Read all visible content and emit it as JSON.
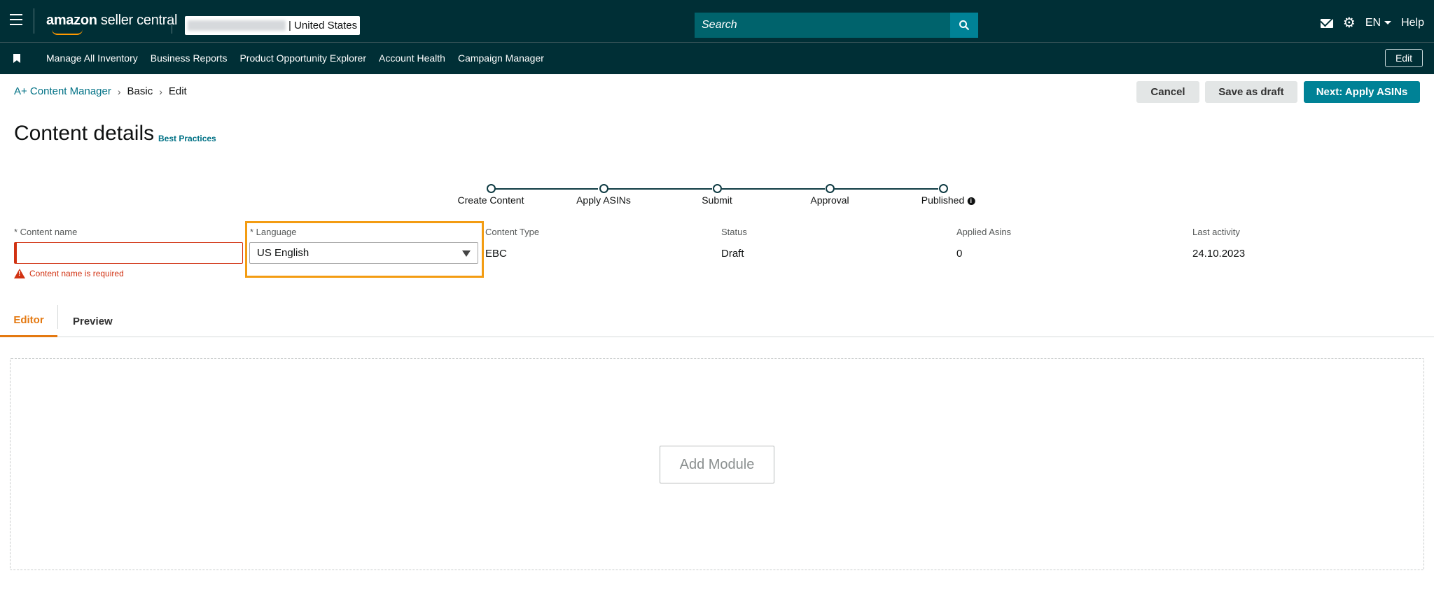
{
  "header": {
    "logo_bold": "amazon",
    "logo_rest": " seller central",
    "store_name": "| United States",
    "search_placeholder": "Search",
    "language": "EN",
    "help": "Help"
  },
  "nav": {
    "items": [
      "Manage All Inventory",
      "Business Reports",
      "Product Opportunity Explorer",
      "Account Health",
      "Campaign Manager"
    ],
    "edit_label": "Edit"
  },
  "breadcrumb": {
    "items": [
      "A+ Content Manager",
      "Basic",
      "Edit"
    ]
  },
  "actions": {
    "cancel": "Cancel",
    "save_draft": "Save as draft",
    "next": "Next: Apply ASINs"
  },
  "page": {
    "title": "Content details",
    "best_practices": "Best Practices"
  },
  "stepper": {
    "steps": [
      "Create Content",
      "Apply ASINs",
      "Submit",
      "Approval",
      "Published"
    ],
    "info_glyph": "i"
  },
  "form": {
    "content_name_label": "* Content name",
    "content_name_value": "",
    "content_name_error": "Content name is required",
    "language_label": "* Language",
    "language_value": "US English",
    "content_type_label": "Content Type",
    "content_type_value": "EBC",
    "status_label": "Status",
    "status_value": "Draft",
    "applied_asins_label": "Applied Asins",
    "applied_asins_value": "0",
    "last_activity_label": "Last activity",
    "last_activity_value": "24.10.2023"
  },
  "tabs": {
    "editor": "Editor",
    "preview": "Preview"
  },
  "editor": {
    "add_module": "Add Module"
  },
  "colors": {
    "header_bg": "#002f36",
    "accent_teal": "#008296",
    "active_tab": "#e47911",
    "error_red": "#d13212",
    "highlight": "#f39c12"
  }
}
